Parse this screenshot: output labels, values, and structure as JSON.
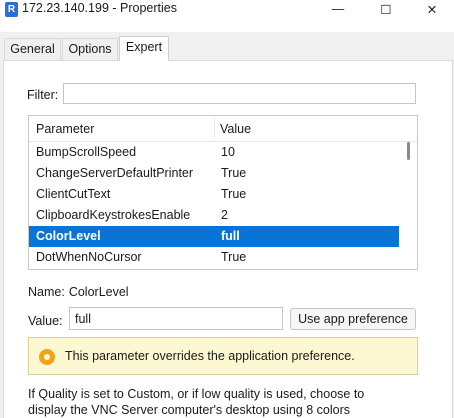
{
  "window": {
    "icon_letter": "R",
    "title": "172.23.140.199 - Properties",
    "minimize_glyph": "—",
    "maximize_glyph": "☐",
    "close_glyph": "✕"
  },
  "tabs": [
    "General",
    "Options",
    "Expert"
  ],
  "active_tab": "Expert",
  "filter": {
    "label": "Filter:",
    "value": ""
  },
  "table": {
    "columns": [
      "Parameter",
      "Value"
    ],
    "rows": [
      {
        "parameter": "BumpScrollSpeed",
        "value": "10",
        "selected": false
      },
      {
        "parameter": "ChangeServerDefaultPrinter",
        "value": "True",
        "selected": false
      },
      {
        "parameter": "ClientCutText",
        "value": "True",
        "selected": false
      },
      {
        "parameter": "ClipboardKeystrokesEnable",
        "value": "2",
        "selected": false
      },
      {
        "parameter": "ColorLevel",
        "value": "full",
        "selected": true
      },
      {
        "parameter": "DotWhenNoCursor",
        "value": "True",
        "selected": false
      }
    ]
  },
  "details": {
    "name_label": "Name:",
    "name_value": "ColorLevel",
    "value_label": "Value:",
    "value": "full",
    "app_pref_button": "Use app preference"
  },
  "notice": {
    "icon": "warning-gear-icon",
    "text": "This parameter overrides the application preference."
  },
  "description": {
    "line1": "If Quality is set to Custom, or if low quality is used, choose to",
    "line2": "display the VNC Server computer's desktop using 8 colors"
  },
  "colors": {
    "selection": "#0a74d6",
    "notice_bg": "#fdf8d2",
    "notice_icon": "#f2a318"
  }
}
